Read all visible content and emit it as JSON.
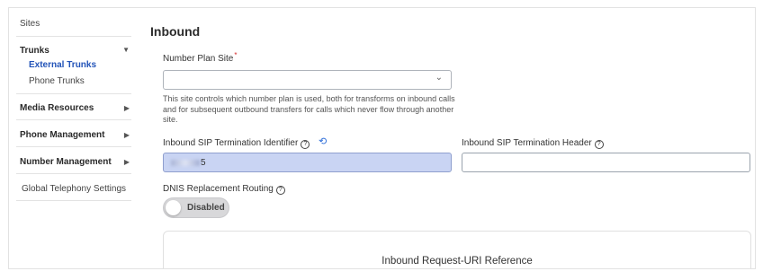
{
  "sidebar": {
    "sites": "Sites",
    "trunks": "Trunks",
    "external_trunks": "External Trunks",
    "phone_trunks": "Phone Trunks",
    "media_resources": "Media Resources",
    "phone_management": "Phone Management",
    "number_management": "Number Management",
    "global_telephony": "Global Telephony Settings"
  },
  "main": {
    "title": "Inbound",
    "number_plan_site_label": "Number Plan Site",
    "required_mark": "*",
    "number_plan_site_value": "",
    "number_plan_hint": "This site controls which number plan is used, both for transforms on inbound calls and for subsequent outbound transfers for calls which never flow through another site.",
    "sip_identifier_label": "Inbound SIP Termination Identifier",
    "sip_identifier_value_suffix": "5",
    "sip_header_label": "Inbound SIP Termination Header",
    "sip_header_value": "",
    "dnis_label": "DNIS Replacement Routing",
    "dnis_toggle_label": "Disabled",
    "request_uri_title": "Inbound Request-URI Reference"
  },
  "icons": {
    "help": "?",
    "reset": "⟲",
    "chevron_down": "⌄",
    "caret_down": "▼",
    "caret_right": "▶"
  },
  "colors": {
    "accent": "#2253b8",
    "required": "#d62b2b",
    "filled_input": "#c9d4f3",
    "reset_icon": "#2a6bd8"
  }
}
